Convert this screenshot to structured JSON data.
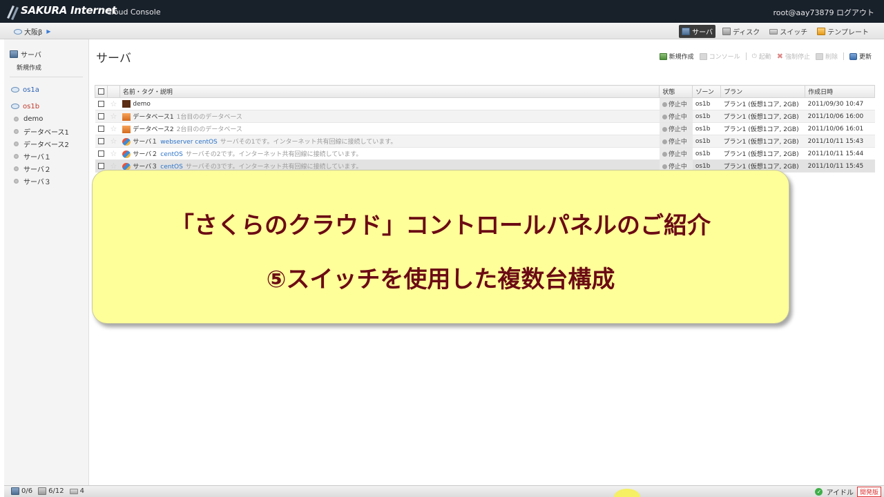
{
  "header": {
    "brand": "SAKURA Internet",
    "subtitle": "Cloud Console",
    "user": "root@aay73879",
    "logout": "ログアウト"
  },
  "subnav": {
    "region": "大阪β",
    "tabs": [
      {
        "label": "サーバ",
        "active": true,
        "icon": "server-icon"
      },
      {
        "label": "ディスク",
        "active": false,
        "icon": "disk-icon"
      },
      {
        "label": "スイッチ",
        "active": false,
        "icon": "switch-icon"
      },
      {
        "label": "テンプレート",
        "active": false,
        "icon": "template-icon"
      }
    ]
  },
  "sidebar": {
    "heading": "サーバ",
    "new": "新規作成",
    "zones": [
      "os1a",
      "os1b"
    ],
    "items": [
      "demo",
      "データベース1",
      "データベース2",
      "サーバ１",
      "サーバ２",
      "サーバ３"
    ]
  },
  "main": {
    "title": "サーバ",
    "toolbar": {
      "create": "新規作成",
      "console": "コンソール",
      "boot": "起動",
      "force_stop": "強制停止",
      "delete": "削除",
      "refresh": "更新"
    },
    "table": {
      "headers": [
        "名前・タグ・説明",
        "状態",
        "ゾーン",
        "プラン",
        "作成日時"
      ],
      "rows": [
        {
          "name": "demo",
          "tags": "",
          "desc": "",
          "state": "停止中",
          "zone": "os1b",
          "plan": "プラン1 (仮想1コア, 2GB)",
          "created": "2011/09/30 10:47"
        },
        {
          "name": "データベース1",
          "tags": "",
          "desc": "1台目ののデータベース",
          "state": "停止中",
          "zone": "os1b",
          "plan": "プラン1 (仮想1コア, 2GB)",
          "created": "2011/10/06 16:00"
        },
        {
          "name": "データベース2",
          "tags": "",
          "desc": "2台目ののデータベース",
          "state": "停止中",
          "zone": "os1b",
          "plan": "プラン1 (仮想1コア, 2GB)",
          "created": "2011/10/06 16:01"
        },
        {
          "name": "サーバ１",
          "tags": "webserver centOS",
          "desc": "サーバその1です。インターネット共有回線に接続しています。",
          "state": "停止中",
          "zone": "os1b",
          "plan": "プラン1 (仮想1コア, 2GB)",
          "created": "2011/10/11 15:43"
        },
        {
          "name": "サーバ２",
          "tags": "centOS",
          "desc": "サーバその2です。インターネット共有回線に接続しています。",
          "state": "停止中",
          "zone": "os1b",
          "plan": "プラン1 (仮想1コア, 2GB)",
          "created": "2011/10/11 15:44"
        },
        {
          "name": "サーバ３",
          "tags": "centOS",
          "desc": "サーバその3です。インターネット共有回線に接続しています。",
          "state": "停止中",
          "zone": "os1b",
          "plan": "プラン1 (仮想1コア, 2GB)",
          "created": "2011/10/11 15:45"
        }
      ]
    }
  },
  "banner": {
    "line1": "「さくらのクラウド」コントロールパネルのご紹介",
    "line2": "⑤スイッチを使用した複数台構成"
  },
  "statusbar": {
    "servers": "0/6",
    "disks": "6/12",
    "switches": "4",
    "status": "アイドル",
    "badge": "開発版"
  }
}
